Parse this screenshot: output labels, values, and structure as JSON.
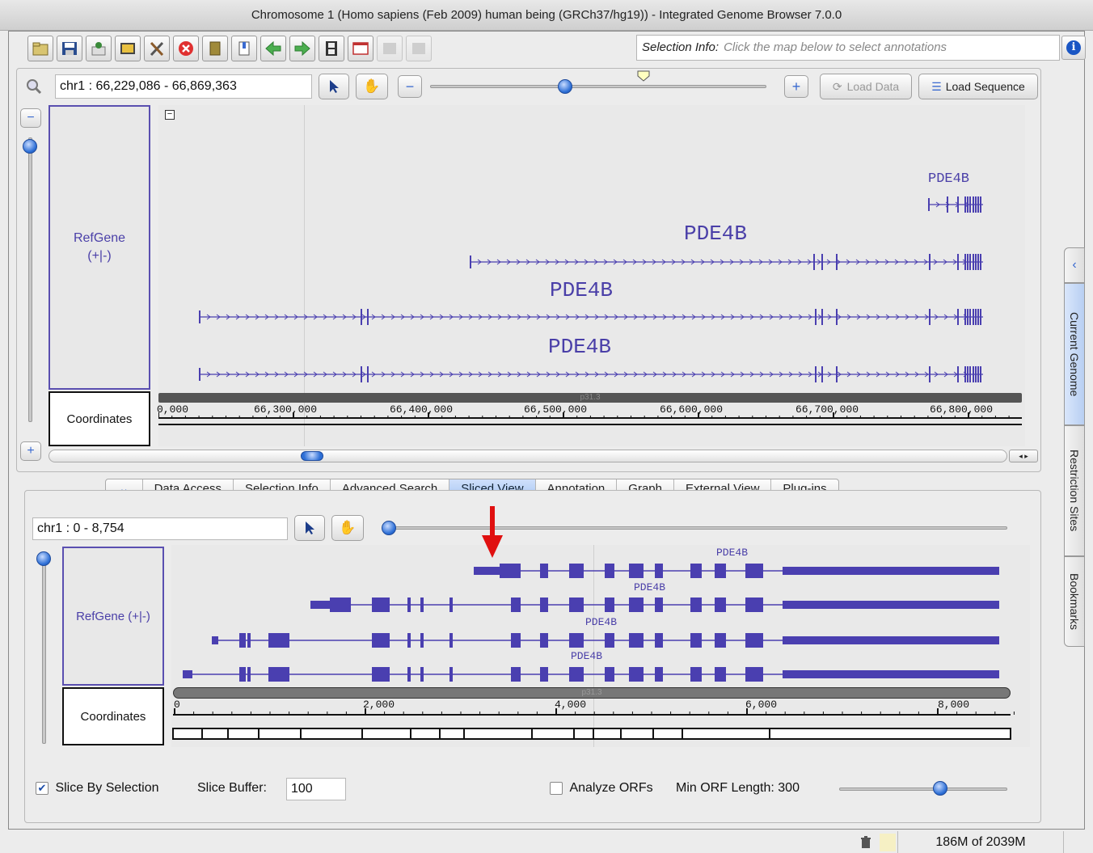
{
  "window": {
    "title": "Chromosome 1  (Homo sapiens (Feb 2009) human being (GRCh37/hg19)) - Integrated Genome Browser 7.0.0"
  },
  "toolbar": {
    "icons": [
      "open-file-icon",
      "save-icon",
      "load-icon",
      "image-icon",
      "tools-icon",
      "stop-icon",
      "bookmark-icon",
      "bookmark-edit-icon",
      "back-icon",
      "forward-icon",
      "movie-icon",
      "window-icon",
      "upload-icon",
      "disabled-icon"
    ],
    "selection_label": "Selection Info:",
    "selection_placeholder": "Click the map below to select annotations"
  },
  "main_view": {
    "location": "chr1 : 66,229,086 - 66,869,363",
    "zoom_level": 0.43,
    "load_data_label": "Load Data",
    "load_sequence_label": "Load Sequence",
    "track_name": "RefGene\n(+|-)",
    "coordinates_label": "Coordinates",
    "scale_label": "p31.3",
    "tick_labels": [
      "0,000",
      "66,300,000",
      "66,400,000",
      "66,500,000",
      "66,600,000",
      "66,700,000",
      "66,800,000"
    ],
    "genes": [
      "PDE4B",
      "PDE4B",
      "PDE4B",
      "PDE4B"
    ]
  },
  "tabs": [
    "Data Access",
    "Selection Info",
    "Advanced Search",
    "Sliced View",
    "Annotation",
    "Graph",
    "External View",
    "Plug-ins"
  ],
  "active_tab": "Sliced View",
  "side_tabs": [
    "Current Genome",
    "Restriction Sites",
    "Bookmarks"
  ],
  "sliced_view": {
    "location": "chr1 : 0 - 8,754",
    "track_name": "RefGene (+|-)",
    "coordinates_label": "Coordinates",
    "scale_label": "p31.3",
    "tick_labels": [
      "0",
      "2,000",
      "4,000",
      "6,000",
      "8,000"
    ],
    "genes": [
      "PDE4B",
      "PDE4B",
      "PDE4B",
      "PDE4B"
    ],
    "slice_by_selection_label": "Slice By Selection",
    "slice_by_selection_checked": true,
    "slice_buffer_label": "Slice Buffer:",
    "slice_buffer_value": "100",
    "analyze_orfs_label": "Analyze ORFs",
    "analyze_orfs_checked": false,
    "min_orf_label": "Min ORF Length: 300"
  },
  "status": {
    "memory": "186M of 2039M"
  },
  "colors": {
    "gene": "#4a3fb0",
    "arrow": "#e01010",
    "active_tab": "#a9c8f3"
  }
}
